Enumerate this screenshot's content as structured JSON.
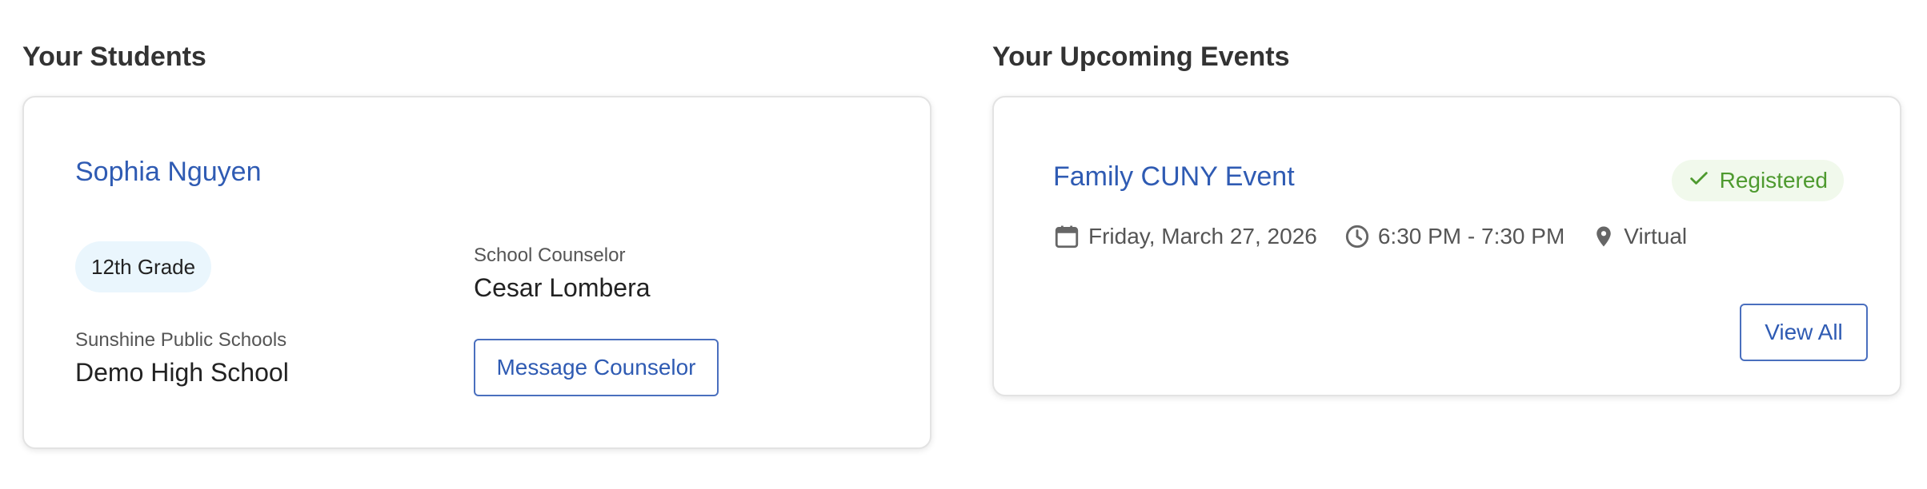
{
  "students": {
    "title": "Your Students",
    "student": {
      "name": "Sophia Nguyen",
      "grade": "12th Grade",
      "district": "Sunshine Public Schools",
      "school": "Demo High School",
      "counselor_label": "School Counselor",
      "counselor_name": "Cesar Lombera",
      "message_button": "Message Counselor"
    }
  },
  "events": {
    "title": "Your Upcoming Events",
    "event": {
      "name": "Family CUNY Event",
      "status": "Registered",
      "date": "Friday, March 27, 2026",
      "time": "6:30 PM - 7:30 PM",
      "location": "Virtual"
    },
    "view_all_button": "View All"
  },
  "colors": {
    "link": "#2f5bb3",
    "registered_text": "#4e9a2f",
    "registered_bg": "#f1f9ec",
    "chip_bg": "#eaf6fd",
    "icon_gray": "#666666"
  },
  "icons": {
    "status": "check-icon",
    "date": "calendar-icon",
    "time": "clock-icon",
    "location": "location-pin-icon"
  }
}
